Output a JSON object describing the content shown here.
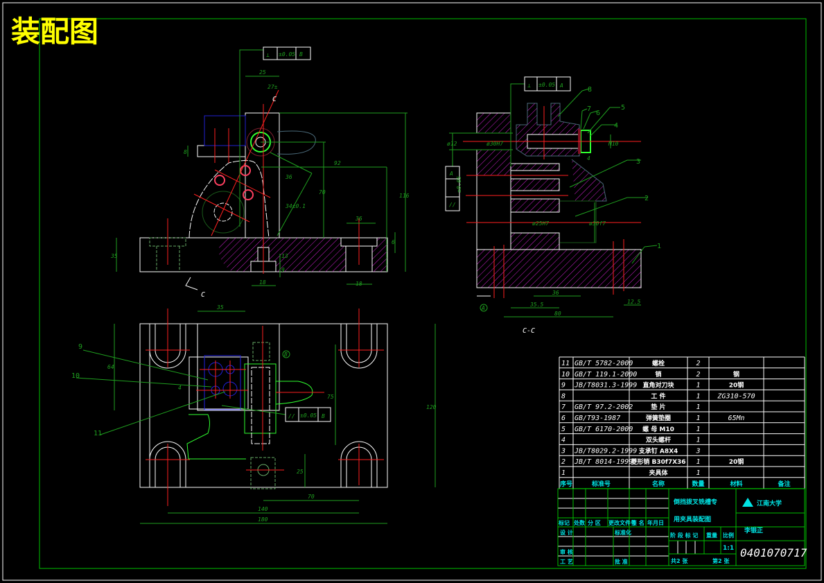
{
  "title": "装配图",
  "colors": {
    "outline": "#ffffff",
    "dimension": "#1fa01f",
    "centerline": "#ff2020",
    "hatch": "#d020d0",
    "title": "#ffff00",
    "titleblock_text": "#00e5e5",
    "frame": "#00c000"
  },
  "front_view": {
    "tolerance_frame": [
      "⊥",
      "±0.05",
      "B"
    ],
    "section_mark": "C",
    "dimensions": [
      "25",
      "27±",
      "8",
      "92",
      "70",
      "116",
      "36",
      "6",
      "35",
      "18",
      "13",
      "18",
      "9",
      "36",
      "34±0.1"
    ]
  },
  "section_view": {
    "label": "C-C",
    "tolerance_top": [
      "⊥",
      "±0.05",
      "A"
    ],
    "tolerance_left": [
      "//",
      "±0.05",
      "A"
    ],
    "datum": "A",
    "dimensions": [
      "ø12",
      "ø30H7",
      "M10",
      "4",
      "36",
      "35.5",
      "80",
      "12.5",
      "ø30f7",
      "ø25H7"
    ],
    "balloons": [
      "1",
      "2",
      "3",
      "4",
      "5",
      "6",
      "7",
      "8"
    ]
  },
  "top_view": {
    "tolerance_frame": [
      "//",
      "±0.05",
      "B"
    ],
    "datum": "B",
    "dimensions": [
      "35",
      "64",
      "75",
      "120",
      "25",
      "70",
      "140",
      "180",
      "4"
    ],
    "balloons": [
      "9",
      "10",
      "11"
    ]
  },
  "parts_list": {
    "headers": [
      "序号",
      "标准号",
      "名称",
      "数量",
      "材料",
      "备注"
    ],
    "rows": [
      [
        "11",
        "GB/T 5782-2000",
        "螺栓",
        "2",
        "",
        ""
      ],
      [
        "10",
        "GB/T 119.1-2000",
        "销",
        "2",
        "钢",
        ""
      ],
      [
        "9",
        "JB/T8031.3-1999",
        "直角对刀块",
        "1",
        "20钢",
        ""
      ],
      [
        "8",
        "",
        "工 件",
        "1",
        "ZG310-570",
        ""
      ],
      [
        "7",
        "GB/T 97.2-2002",
        "垫 片",
        "1",
        "",
        ""
      ],
      [
        "6",
        "GB/T93-1987",
        "弹簧垫圈",
        "1",
        "65Mn",
        ""
      ],
      [
        "5",
        "GB/T 6170-2000",
        "螺 母 M10",
        "1",
        "",
        ""
      ],
      [
        "4",
        "",
        "双头螺杆",
        "1",
        "",
        ""
      ],
      [
        "3",
        "JB/T8029.2-1999",
        "支承钉 A8X4",
        "3",
        "",
        ""
      ],
      [
        "2",
        "JB/T 8014-1999",
        "菱形销 B30f7X36",
        "1",
        "20钢",
        ""
      ],
      [
        "1",
        "",
        "夹具体",
        "1",
        "",
        ""
      ]
    ]
  },
  "title_block": {
    "change_headers": [
      "标记",
      "处数",
      "分 区",
      "更改文件号",
      "签 名",
      "年月日"
    ],
    "design": "设 计",
    "standardize": "标准化",
    "review": "审 核",
    "process": "工 艺",
    "approve": "批 准",
    "drawing_name_line1": "倒挡拨叉铣槽专",
    "drawing_name_line2": "用夹具装配图",
    "stage_headers": [
      "阶 段 标 记",
      "重量",
      "比例"
    ],
    "scale": "1:1",
    "sheets": "共2 张",
    "sheet_no": "第2 张",
    "school": "江南大学",
    "author": "李银正",
    "drawing_number": "0401070717"
  }
}
